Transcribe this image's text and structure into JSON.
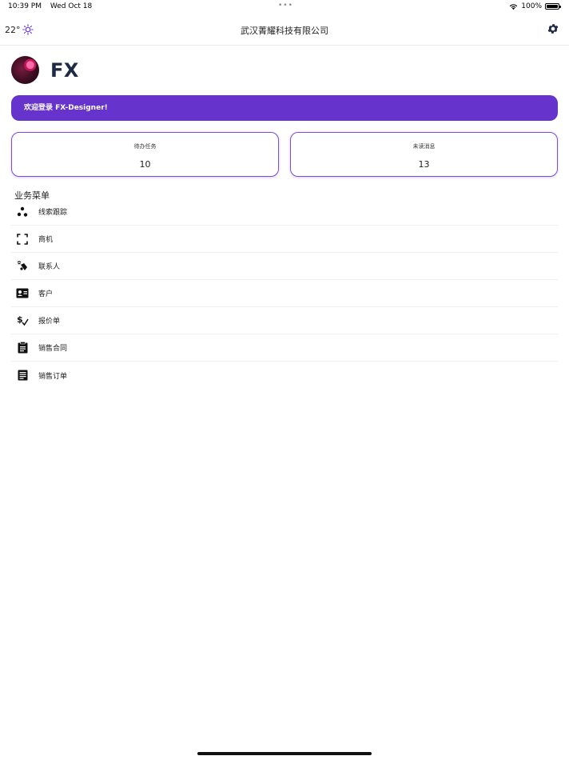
{
  "status_bar": {
    "time": "10:39 PM",
    "date": "Wed Oct 18",
    "battery": "100%"
  },
  "nav": {
    "temperature": "22°",
    "title": "武汉菁耀科技有限公司"
  },
  "profile": {
    "name": "FX"
  },
  "banner": {
    "text": "欢迎登录 FX-Designer!"
  },
  "stats": [
    {
      "label": "待办任务",
      "value": "10"
    },
    {
      "label": "未读消息",
      "value": "13"
    }
  ],
  "menu": {
    "title": "业务菜单",
    "items": [
      {
        "label": "线索跟踪",
        "icon": "scatter-dots-icon"
      },
      {
        "label": "商机",
        "icon": "focus-frame-icon"
      },
      {
        "label": "联系人",
        "icon": "contact-signal-icon"
      },
      {
        "label": "客户",
        "icon": "contact-card-icon"
      },
      {
        "label": "报价单",
        "icon": "price-check-icon"
      },
      {
        "label": "销售合同",
        "icon": "clipboard-icon"
      },
      {
        "label": "销售订单",
        "icon": "list-document-icon"
      }
    ]
  },
  "colors": {
    "accent": "#6633cc",
    "card_border": "#7c4ddb",
    "title_text": "#1f2a44"
  }
}
